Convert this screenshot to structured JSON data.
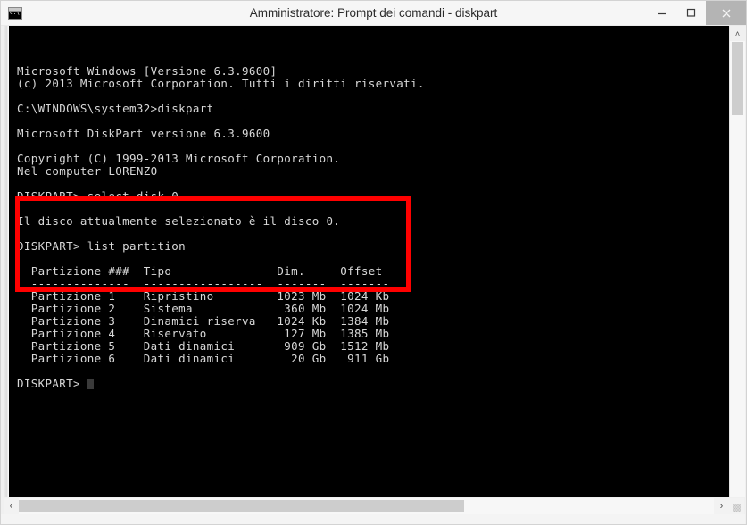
{
  "window": {
    "title": "Amministratore: Prompt dei comandi - diskpart",
    "icon_name": "cmd-console-icon",
    "icon_label": "C:\\",
    "buttons": {
      "minimize": "Riduci a icona",
      "maximize": "Ingrandisci",
      "close": "Chiudi"
    }
  },
  "console": {
    "lines": [
      "Microsoft Windows [Versione 6.3.9600]",
      "(c) 2013 Microsoft Corporation. Tutti i diritti riservati.",
      "",
      "C:\\WINDOWS\\system32>diskpart",
      "",
      "Microsoft DiskPart versione 6.3.9600",
      "",
      "Copyright (C) 1999-2013 Microsoft Corporation.",
      "Nel computer LORENZO",
      "",
      "DISKPART> select disk 0",
      "",
      "Il disco attualmente selezionato è il disco 0.",
      "",
      "DISKPART> list partition",
      "",
      "  Partizione ###  Tipo               Dim.     Offset",
      "  --------------  -----------------  -------  -------",
      "  Partizione 1    Ripristino         1023 Mb  1024 Kb",
      "  Partizione 2    Sistema             360 Mb  1024 Mb",
      "  Partizione 3    Dinamici riserva   1024 Kb  1384 Mb",
      "  Partizione 4    Riservato           127 Mb  1385 Mb",
      "  Partizione 5    Dati dinamici       909 Gb  1512 Mb",
      "  Partizione 6    Dati dinamici        20 Gb   911 Gb",
      "",
      "DISKPART>"
    ],
    "prompt": "DISKPART>",
    "colors": {
      "background": "#000000",
      "foreground": "#d8d8d8",
      "annotation": "#ff0000"
    }
  },
  "partition_table": {
    "headers": [
      "Partizione ###",
      "Tipo",
      "Dim.",
      "Offset"
    ],
    "rows": [
      {
        "partition": "Partizione 1",
        "tipo": "Ripristino",
        "dim": "1023 Mb",
        "offset": "1024 Kb"
      },
      {
        "partition": "Partizione 2",
        "tipo": "Sistema",
        "dim": "360 Mb",
        "offset": "1024 Mb"
      },
      {
        "partition": "Partizione 3",
        "tipo": "Dinamici riserva",
        "dim": "1024 Kb",
        "offset": "1384 Mb"
      },
      {
        "partition": "Partizione 4",
        "tipo": "Riservato",
        "dim": "127 Mb",
        "offset": "1385 Mb"
      },
      {
        "partition": "Partizione 5",
        "tipo": "Dati dinamici",
        "dim": "909 Gb",
        "offset": "1512 Mb"
      },
      {
        "partition": "Partizione 6",
        "tipo": "Dati dinamici",
        "dim": "20 Gb",
        "offset": "911 Gb"
      }
    ]
  },
  "scrollbars": {
    "vertical": {
      "up_arrow": "˄",
      "down_arrow": "˅"
    },
    "horizontal": {
      "left_arrow": "‹",
      "right_arrow": "›"
    }
  }
}
